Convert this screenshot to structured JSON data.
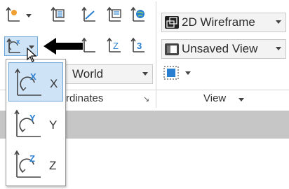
{
  "visual_styles": {
    "selected": "2D Wireframe"
  },
  "views": {
    "selected": "Unsaved View"
  },
  "coordinates": {
    "ucs_selected": "World",
    "panel_label": "rdinates"
  },
  "view_panel": {
    "label": "View"
  },
  "flyout": {
    "items": [
      {
        "label": "X",
        "axis": "X"
      },
      {
        "label": "Y",
        "axis": "Y"
      },
      {
        "label": "Z",
        "axis": "Z"
      }
    ]
  },
  "colors": {
    "accent": "#1e78c8",
    "highlight": "#cfe3f6",
    "axis_blue": "#2b7fd0",
    "orange": "#f0a030"
  }
}
